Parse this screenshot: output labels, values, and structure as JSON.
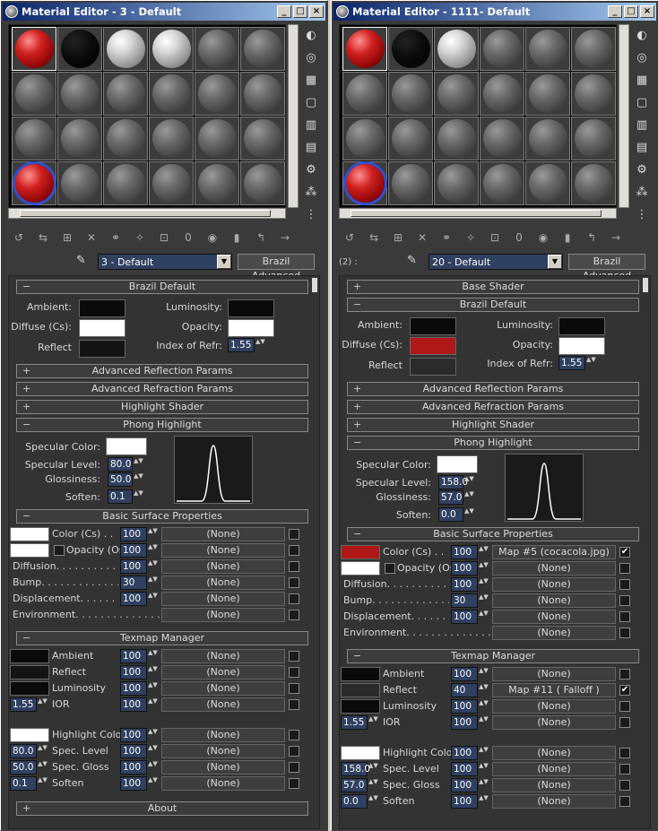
{
  "windows": [
    {
      "title": "Material Editor - 3 - Default",
      "material_name": "3 - Default",
      "material_type": "Brazil Advanced",
      "count_label": "",
      "slots": [
        "coke",
        "black",
        "white",
        "white",
        "gray",
        "gray",
        "gray",
        "gray",
        "gray",
        "gray",
        "gray",
        "gray",
        "gray",
        "gray",
        "gray",
        "gray",
        "gray",
        "gray",
        "check",
        "gray",
        "gray",
        "gray",
        "gray",
        "gray"
      ],
      "rollouts": {
        "brazil_default": "Brazil Default",
        "adv_refl": "Advanced Reflection Params",
        "adv_refr": "Advanced Refraction Params",
        "highlight_shader": "Highlight Shader",
        "phong": "Phong Highlight",
        "basic_surface": "Basic Surface Properties",
        "texmap": "Texmap Manager",
        "about": "About"
      },
      "brazil": {
        "ambient_label": "Ambient:",
        "ambient_color": "#0a0a0a",
        "luminosity_label": "Luminosity:",
        "luminosity_color": "#0a0a0a",
        "diffuse_label": "Diffuse (Cs):",
        "diffuse_color": "#ffffff",
        "opacity_label": "Opacity:",
        "opacity_color": "#ffffff",
        "reflect_label": "Reflect",
        "reflect_color": "#141414",
        "ior_label": "Index of Refr:",
        "ior": "1.55"
      },
      "phong": {
        "spec_color_label": "Specular Color:",
        "spec_color": "#ffffff",
        "spec_level_label": "Specular Level:",
        "spec_level": "80.0",
        "gloss_label": "Glossiness:",
        "gloss": "50.0",
        "soften_label": "Soften:",
        "soften": "0.1"
      },
      "basic": [
        {
          "label": "Color (Cs) . . . . .",
          "swatch": "#ffffff",
          "amount": "100",
          "map": "(None)",
          "checked": false
        },
        {
          "label": "Opacity (Os)",
          "swatch": "#ffffff",
          "amount": "100",
          "map": "(None)",
          "checked": false
        },
        {
          "label": "Diffusion. . . . . . . . . . . .",
          "swatch": "",
          "amount": "100",
          "map": "(None)",
          "checked": false
        },
        {
          "label": "Bump. . . . . . . . . . . . . . .",
          "swatch": "",
          "amount": "30",
          "map": "(None)",
          "checked": false
        },
        {
          "label": "Displacement. . . . . . . . .",
          "swatch": "",
          "amount": "100",
          "map": "(None)",
          "checked": false
        },
        {
          "label": "Environment. . . . . . . . . . . . . . . . .",
          "swatch": "",
          "amount": "",
          "map": "(None)",
          "checked": false
        }
      ],
      "texmap": [
        {
          "label": "Ambient",
          "swatch": "#0a0a0a",
          "value": "",
          "amount": "100",
          "map": "(None)",
          "checked": false
        },
        {
          "label": "Reflect",
          "swatch": "#141414",
          "value": "",
          "amount": "100",
          "map": "(None)",
          "checked": false
        },
        {
          "label": "Luminosity",
          "swatch": "#0a0a0a",
          "value": "",
          "amount": "100",
          "map": "(None)",
          "checked": false
        },
        {
          "label": "IOR",
          "swatch": "",
          "value": "1.55",
          "amount": "100",
          "map": "(None)",
          "checked": false
        },
        {
          "label": "Highlight Color",
          "swatch": "#ffffff",
          "value": "",
          "amount": "100",
          "map": "(None)",
          "checked": false
        },
        {
          "label": "Spec. Level",
          "swatch": "",
          "value": "80.0",
          "amount": "100",
          "map": "(None)",
          "checked": false
        },
        {
          "label": "Spec. Gloss",
          "swatch": "",
          "value": "50.0",
          "amount": "100",
          "map": "(None)",
          "checked": false
        },
        {
          "label": "Soften",
          "swatch": "",
          "value": "0.1",
          "amount": "100",
          "map": "(None)",
          "checked": false
        }
      ]
    },
    {
      "title": "Material Editor - 1111- Default",
      "material_name": "20 - Default",
      "material_type": "Brazil Advanced",
      "count_label": "(2) :",
      "slots": [
        "coke",
        "black",
        "white",
        "gray",
        "gray",
        "gray",
        "gray",
        "gray",
        "gray",
        "gray",
        "gray",
        "gray",
        "gray",
        "gray",
        "gray",
        "gray",
        "gray",
        "gray",
        "check",
        "gray",
        "gray",
        "gray",
        "gray",
        "gray"
      ],
      "rollouts": {
        "base_shader": "Base Shader",
        "brazil_default": "Brazil Default",
        "adv_refl": "Advanced Reflection Params",
        "adv_refr": "Advanced Refraction Params",
        "highlight_shader": "Highlight Shader",
        "phong": "Phong Highlight",
        "basic_surface": "Basic Surface Properties",
        "texmap": "Texmap Manager"
      },
      "brazil": {
        "ambient_label": "Ambient:",
        "ambient_color": "#0a0a0a",
        "luminosity_label": "Luminosity:",
        "luminosity_color": "#0a0a0a",
        "diffuse_label": "Diffuse (Cs):",
        "diffuse_color": "#b01818",
        "opacity_label": "Opacity:",
        "opacity_color": "#ffffff",
        "reflect_label": "Reflect",
        "reflect_color": "#2a2a2a",
        "ior_label": "Index of Refr:",
        "ior": "1.55"
      },
      "phong": {
        "spec_color_label": "Specular Color:",
        "spec_color": "#ffffff",
        "spec_level_label": "Specular Level:",
        "spec_level": "158.0",
        "gloss_label": "Glossiness:",
        "gloss": "57.0",
        "soften_label": "Soften:",
        "soften": "0.0"
      },
      "basic": [
        {
          "label": "Color (Cs) . . . . .",
          "swatch": "#b01818",
          "amount": "100",
          "map": "Map #5 (cocacola.jpg)",
          "checked": true
        },
        {
          "label": "Opacity (Os)",
          "swatch": "#ffffff",
          "amount": "100",
          "map": "(None)",
          "checked": false
        },
        {
          "label": "Diffusion. . . . . . . . . . . .",
          "swatch": "",
          "amount": "100",
          "map": "(None)",
          "checked": false
        },
        {
          "label": "Bump. . . . . . . . . . . . . . .",
          "swatch": "",
          "amount": "30",
          "map": "(None)",
          "checked": false
        },
        {
          "label": "Displacement. . . . . . . . .",
          "swatch": "",
          "amount": "100",
          "map": "(None)",
          "checked": false
        },
        {
          "label": "Environment. . . . . . . . . . . . . . . . .",
          "swatch": "",
          "amount": "",
          "map": "(None)",
          "checked": false
        }
      ],
      "texmap": [
        {
          "label": "Ambient",
          "swatch": "#0a0a0a",
          "value": "",
          "amount": "100",
          "map": "(None)",
          "checked": false
        },
        {
          "label": "Reflect",
          "swatch": "#2a2a2a",
          "value": "",
          "amount": "40",
          "map": "Map #11  ( Falloff )",
          "checked": true
        },
        {
          "label": "Luminosity",
          "swatch": "#0a0a0a",
          "value": "",
          "amount": "100",
          "map": "(None)",
          "checked": false
        },
        {
          "label": "IOR",
          "swatch": "",
          "value": "1.55",
          "amount": "100",
          "map": "(None)",
          "checked": false
        },
        {
          "label": "Highlight Color",
          "swatch": "#ffffff",
          "value": "",
          "amount": "100",
          "map": "(None)",
          "checked": false
        },
        {
          "label": "Spec. Level",
          "swatch": "",
          "value": "158.0",
          "amount": "100",
          "map": "(None)",
          "checked": false
        },
        {
          "label": "Spec. Gloss",
          "swatch": "",
          "value": "57.0",
          "amount": "100",
          "map": "(None)",
          "checked": false
        },
        {
          "label": "Soften",
          "swatch": "",
          "value": "0.0",
          "amount": "100",
          "map": "(None)",
          "checked": false
        }
      ]
    }
  ]
}
